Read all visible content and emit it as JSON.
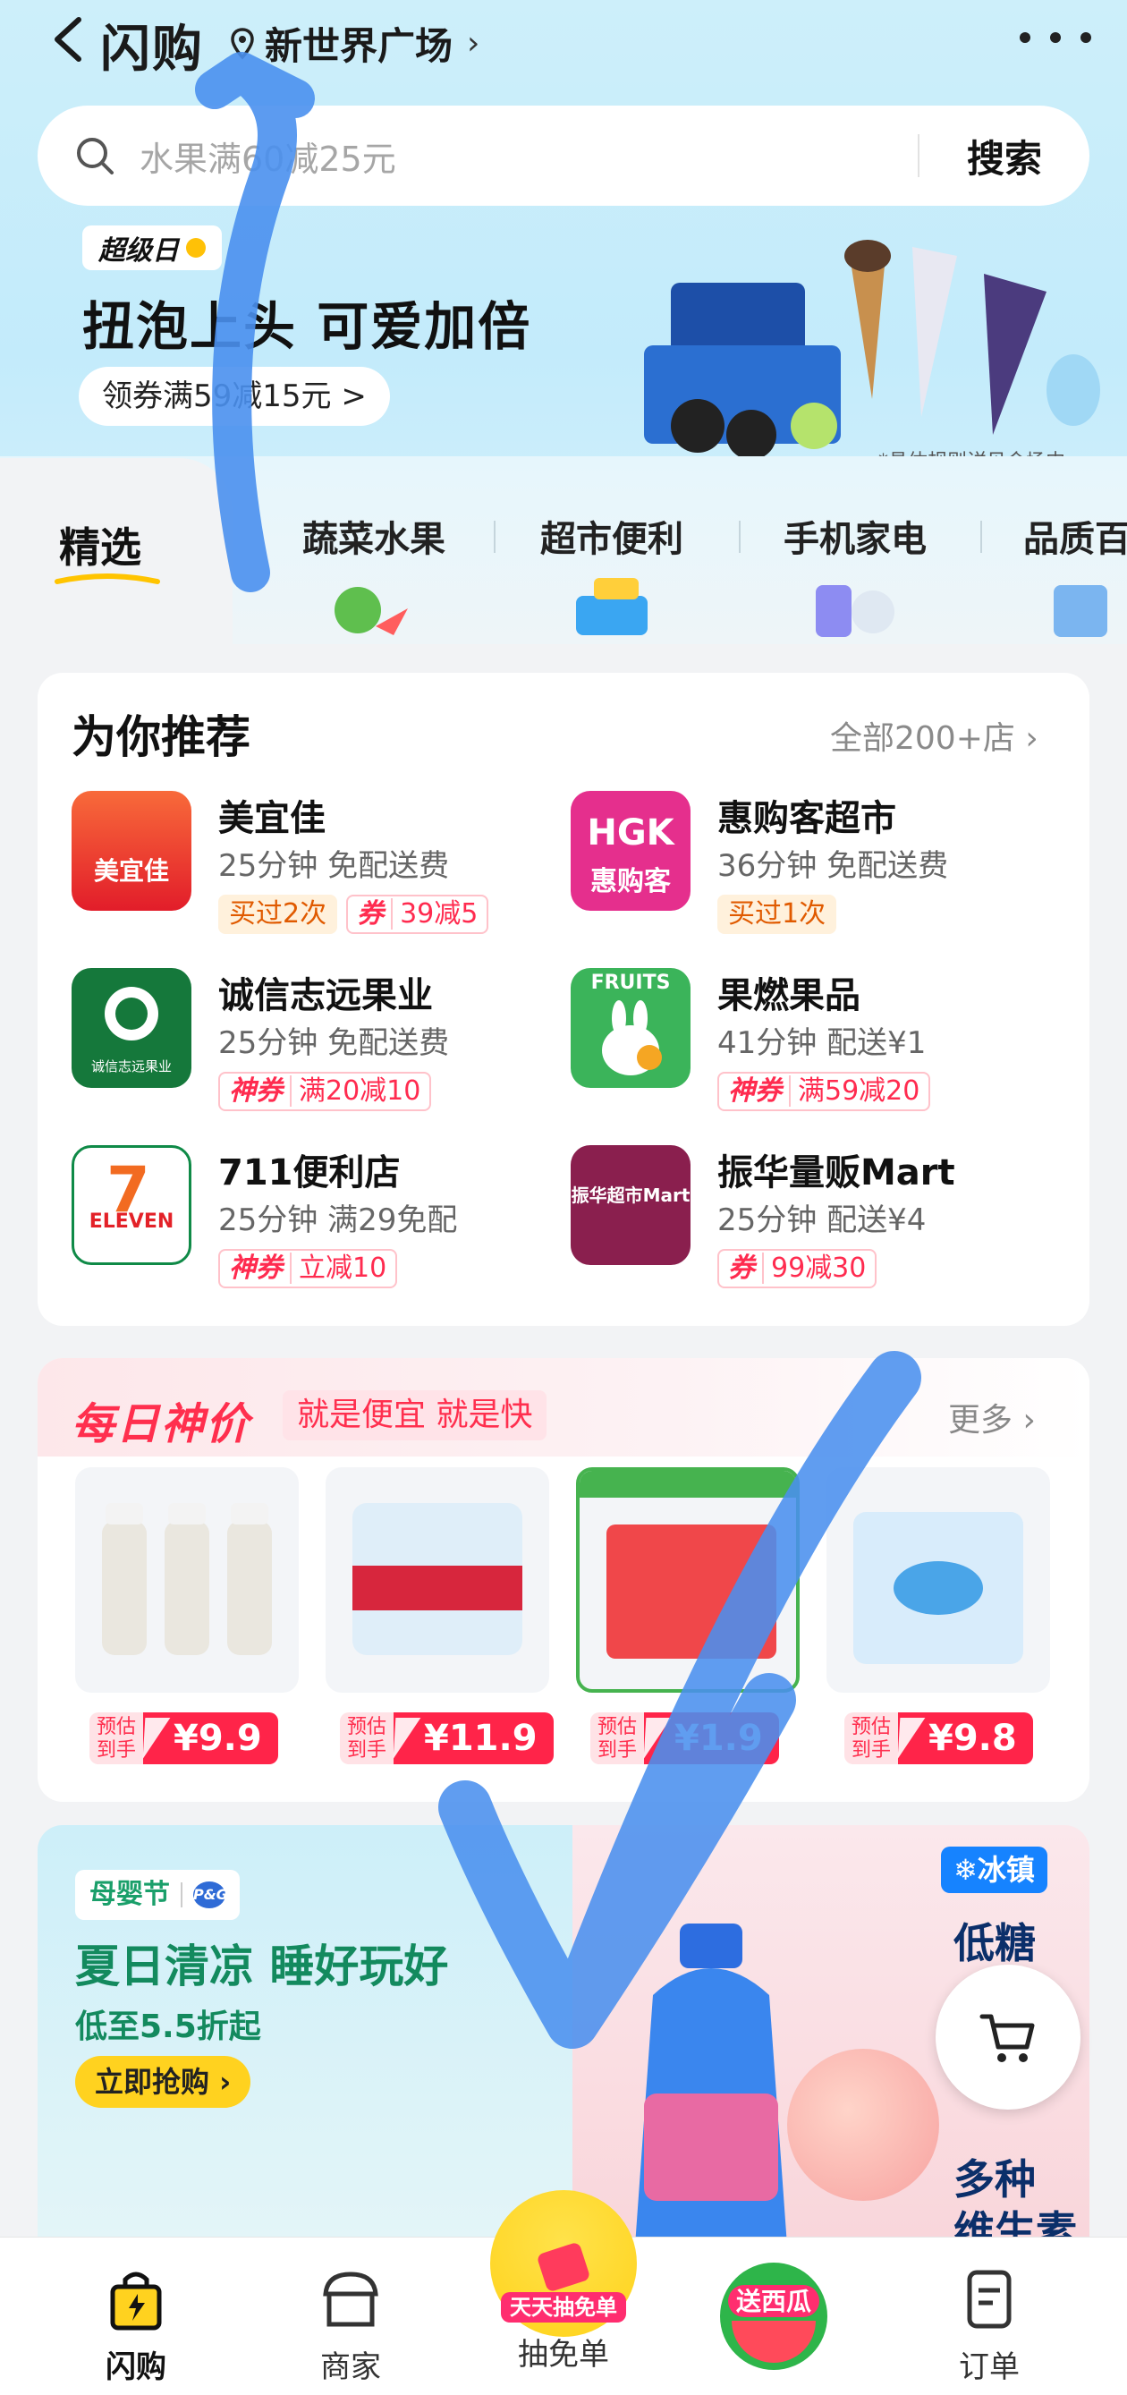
{
  "header": {
    "title": "闪购",
    "location": "新世界广场",
    "location_chevron": "›"
  },
  "search": {
    "placeholder": "水果满60减25元",
    "button": "搜索"
  },
  "promo": {
    "tag": "超级日",
    "title": "扭泡上头 可爱加倍",
    "coupon": "领券满59减15元 >",
    "note": "*具体规则详见会场内"
  },
  "categories": {
    "selected": "精选",
    "tabs": [
      "蔬菜水果",
      "超市便利",
      "手机家电",
      "品质百货"
    ]
  },
  "recommend": {
    "title": "为你推荐",
    "all_link": "全部200+店 ›",
    "shops": [
      {
        "name": "美宜佳",
        "meta": "25分钟 免配送费",
        "logo_text": "美宜佳",
        "tags": [
          {
            "type": "y",
            "text": "买过2次"
          },
          {
            "type": "r",
            "pre": "券",
            "text": "39减5"
          }
        ]
      },
      {
        "name": "惠购客超市",
        "meta": "36分钟 免配送费",
        "logo_text": "HGK",
        "logo_sub": "惠购客",
        "tags": [
          {
            "type": "y",
            "text": "买过1次"
          }
        ]
      },
      {
        "name": "诚信志远果业",
        "meta": "25分钟 免配送费",
        "logo_text": "诚信志远果业",
        "tags": [
          {
            "type": "r",
            "pre": "神券",
            "text": "满20减10"
          }
        ]
      },
      {
        "name": "果燃果品",
        "meta": "41分钟 配送¥1",
        "logo_text": "FRUITS",
        "tags": [
          {
            "type": "r",
            "pre": "神券",
            "text": "满59减20"
          }
        ]
      },
      {
        "name": "711便利店",
        "meta": "25分钟 满29免配",
        "logo_text": "ELEVEN",
        "tags": [
          {
            "type": "r",
            "pre": "神券",
            "text": "立减10"
          }
        ]
      },
      {
        "name": "振华量贩Mart",
        "meta": "25分钟 配送¥4",
        "logo_text": "振华超市Mart",
        "tags": [
          {
            "type": "r",
            "pre": "券",
            "text": "99减30"
          }
        ]
      }
    ]
  },
  "daily": {
    "title": "每日神价",
    "subtitle": "就是便宜 就是快",
    "more": "更多 ›",
    "price_prefix": "预估到手",
    "products": [
      {
        "price": "¥9.9"
      },
      {
        "price": "¥11.9"
      },
      {
        "price": "¥1.9"
      },
      {
        "price": "¥9.8"
      }
    ]
  },
  "banner": {
    "tag": "母婴节",
    "brand_mark": "P&G",
    "title": "夏日清凉 睡好玩好",
    "subtitle": "低至5.5折起",
    "button": "立即抢购 ›",
    "ice_badge": "❄冰镇",
    "side_1": "低糖",
    "side_2": "多种",
    "side_3": "维生素"
  },
  "nav": {
    "items": [
      "闪购",
      "商家",
      "抽免单",
      "送西瓜",
      "订单"
    ],
    "mid_text": "天天抽免单"
  },
  "colors": {
    "accent_red": "#ff2449",
    "header_blue": "#c3ebfb",
    "stroke_blue": "#4a90ee"
  }
}
